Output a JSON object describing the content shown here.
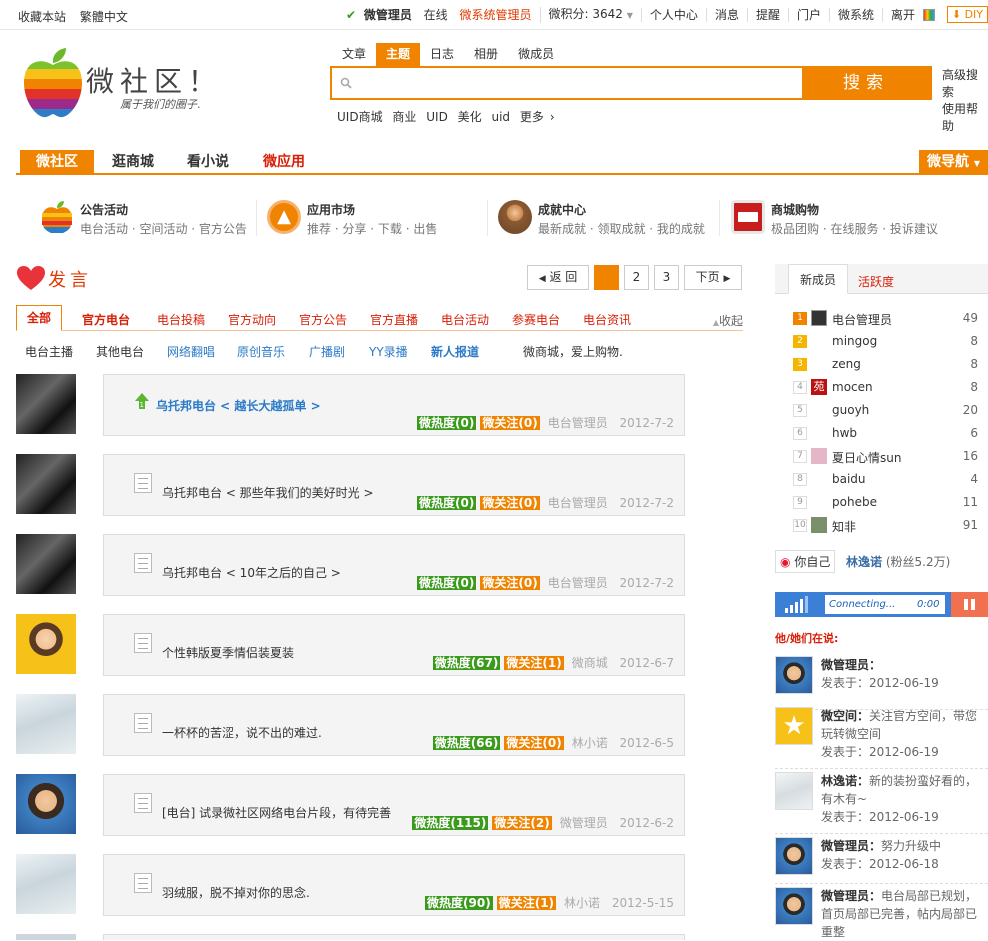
{
  "topbar": {
    "left": [
      "收藏本站",
      "繁體中文"
    ],
    "user": "微管理员",
    "online": "在线",
    "group": "微系统管理员",
    "points": "微积分: 3642",
    "links": [
      "个人中心",
      "消息",
      "提醒",
      "门户",
      "微系统",
      "离开"
    ],
    "diy": "DIY"
  },
  "logo": {
    "title": "微社区！",
    "slogan": "属于我们的圈子."
  },
  "search": {
    "tabs": [
      "文章",
      "主题",
      "日志",
      "相册",
      "微成员"
    ],
    "active_tab": "主题",
    "placeholder": "",
    "button": "搜索",
    "advanced": "高级搜索",
    "help": "使用帮助",
    "hot": [
      "UID商城",
      "商业",
      "UID",
      "美化",
      "uid",
      "更多"
    ]
  },
  "nav": {
    "items": [
      "微社区",
      "逛商城",
      "看小说",
      "微应用"
    ],
    "right": "微导航"
  },
  "quick": [
    {
      "title": "公告活动",
      "sub": "电台活动 · 空间活动 · 官方公告"
    },
    {
      "title": "应用市场",
      "sub": "推荐 · 分享 · 下载 · 出售"
    },
    {
      "title": "成就中心",
      "sub": "最新成就 · 领取成就 · 我的成就"
    },
    {
      "title": "商城购物",
      "sub": "极品团购 · 在线服务 · 投诉建议"
    }
  ],
  "main": {
    "heading": "发言",
    "pager": {
      "back": "返 回",
      "pages": [
        "1",
        "2",
        "3"
      ],
      "next": "下页"
    },
    "cats1": [
      "全部",
      "官方电台",
      "电台投稿",
      "官方动向",
      "官方公告",
      "官方直播",
      "电台活动",
      "参赛电台",
      "电台资讯"
    ],
    "collapse": "收起",
    "cats2": [
      "电台主播",
      "其他电台",
      "网络翻唱",
      "原创音乐",
      "广播剧",
      "YY录播",
      "新人报道",
      "微商城，爱上购物."
    ],
    "posts": [
      {
        "title": "乌托邦电台 < 越长大越孤单 >",
        "heat": "微热度(0)",
        "follow": "微关注(0)",
        "author": "电台管理员",
        "date": "2012-7-2",
        "top": true
      },
      {
        "title": "乌托邦电台 < 那些年我们的美好时光 >",
        "heat": "微热度(0)",
        "follow": "微关注(0)",
        "author": "电台管理员",
        "date": "2012-7-2"
      },
      {
        "title": "乌托邦电台 < 10年之后的自己 >",
        "heat": "微热度(0)",
        "follow": "微关注(0)",
        "author": "电台管理员",
        "date": "2012-7-2"
      },
      {
        "title": "个性韩版夏季情侣装夏装",
        "heat": "微热度(67)",
        "follow": "微关注(1)",
        "author": "微商城",
        "date": "2012-6-7"
      },
      {
        "title": "一杯杯的苦涩，说不出的难过.",
        "heat": "微热度(66)",
        "follow": "微关注(0)",
        "author": "林小诺",
        "date": "2012-6-5"
      },
      {
        "title": "[电台] 试录微社区网络电台片段，有待完善",
        "heat": "微热度(115)",
        "follow": "微关注(2)",
        "author": "微管理员",
        "date": "2012-6-2"
      },
      {
        "title": "羽绒服，脱不掉对你的思念.",
        "heat": "微热度(90)",
        "follow": "微关注(1)",
        "author": "林小诺",
        "date": "2012-5-15"
      }
    ]
  },
  "sidebar": {
    "tabs": [
      "新成员",
      "活跃度"
    ],
    "ranking": [
      {
        "n": "1",
        "name": "电台管理员",
        "count": "49"
      },
      {
        "n": "2",
        "name": "mingog",
        "count": "8"
      },
      {
        "n": "3",
        "name": "zeng",
        "count": "8"
      },
      {
        "n": "4",
        "name": "mocen",
        "count": "8"
      },
      {
        "n": "5",
        "name": "guoyh",
        "count": "20"
      },
      {
        "n": "6",
        "name": "hwb",
        "count": "6"
      },
      {
        "n": "7",
        "name": "夏日心情sun",
        "count": "16"
      },
      {
        "n": "8",
        "name": "baidu",
        "count": "4"
      },
      {
        "n": "9",
        "name": "pohebe",
        "count": "11"
      },
      {
        "n": "10",
        "name": "知非",
        "count": "91"
      }
    ],
    "weibo_btn": "你自己",
    "weibo_name": "林逸诺",
    "weibo_fans": "(粉丝5.2万)",
    "player": {
      "status": "Connecting...",
      "time": "0:00"
    },
    "say_heading": "他/她们在说:",
    "messages": [
      {
        "name": "微管理员：",
        "text": "",
        "date": "发表于：2012-06-19"
      },
      {
        "name": "微空间：",
        "text": "关注官方空间，带您玩转微空间",
        "date": "发表于：2012-06-19"
      },
      {
        "name": "林逸诺：",
        "text": "新的装扮蛮好看的，有木有~",
        "date": "发表于：2012-06-19"
      },
      {
        "name": "微管理员：",
        "text": "努力升级中",
        "date": "发表于：2012-06-18"
      },
      {
        "name": "微管理员：",
        "text": "电台局部已规划，首页局部已完善，帖内局部已重整",
        "date": ""
      }
    ]
  },
  "colors": {
    "accent": "#f08300",
    "red": "#d81e06",
    "green": "#3a9a1b"
  }
}
